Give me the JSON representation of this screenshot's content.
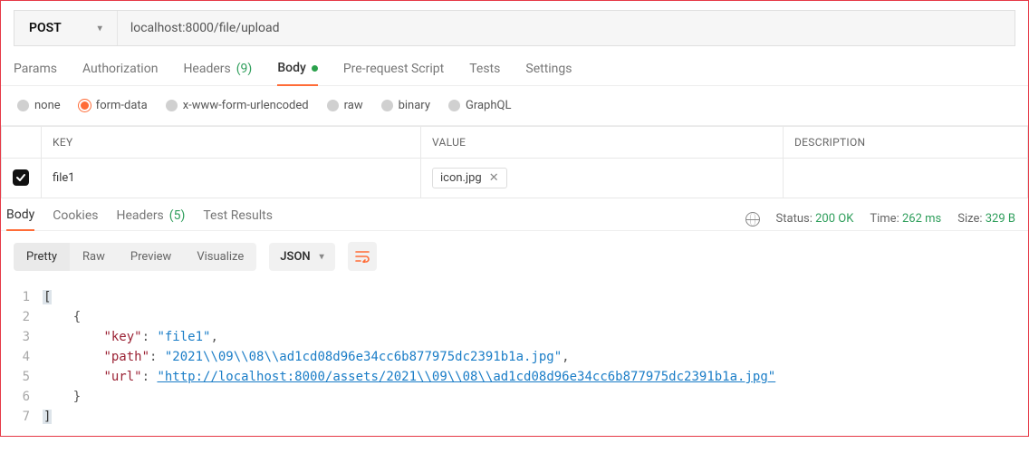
{
  "request": {
    "method": "POST",
    "url": "localhost:8000/file/upload"
  },
  "request_tabs": {
    "params": "Params",
    "auth": "Authorization",
    "headers_label": "Headers",
    "headers_count": "(9)",
    "body": "Body",
    "prereq": "Pre-request Script",
    "tests": "Tests",
    "settings": "Settings"
  },
  "body_types": {
    "none": "none",
    "formdata": "form-data",
    "urlencoded": "x-www-form-urlencoded",
    "raw": "raw",
    "binary": "binary",
    "graphql": "GraphQL"
  },
  "kv_headers": {
    "key": "KEY",
    "value": "VALUE",
    "desc": "DESCRIPTION"
  },
  "row1": {
    "key": "file1",
    "file": "icon.jpg",
    "desc": ""
  },
  "response_tabs": {
    "body": "Body",
    "cookies": "Cookies",
    "headers_label": "Headers",
    "headers_count": "(5)",
    "tests": "Test Results"
  },
  "status": {
    "status_label": "Status:",
    "status_value": "200 OK",
    "time_label": "Time:",
    "time_value": "262 ms",
    "size_label": "Size:",
    "size_value": "329 B"
  },
  "view_modes": {
    "pretty": "Pretty",
    "raw": "Raw",
    "preview": "Preview",
    "visualize": "Visualize"
  },
  "format": "JSON",
  "code": {
    "ln": {
      "1": "1",
      "2": "2",
      "3": "3",
      "4": "4",
      "5": "5",
      "6": "6",
      "7": "7"
    },
    "l1_open": "[",
    "l2_open": "{",
    "key_key": "\"key\"",
    "key_val": "\"file1\"",
    "path_key": "\"path\"",
    "path_val": "\"2021\\\\09\\\\08\\\\ad1cd08d96e34cc6b877975dc2391b1a.jpg\"",
    "url_key": "\"url\"",
    "url_val": "\"http://localhost:8000/assets/2021\\\\09\\\\08\\\\ad1cd08d96e34cc6b877975dc2391b1a.jpg\"",
    "l6_close": "}",
    "l7_close": "]",
    "colon": ": ",
    "comma": ","
  }
}
